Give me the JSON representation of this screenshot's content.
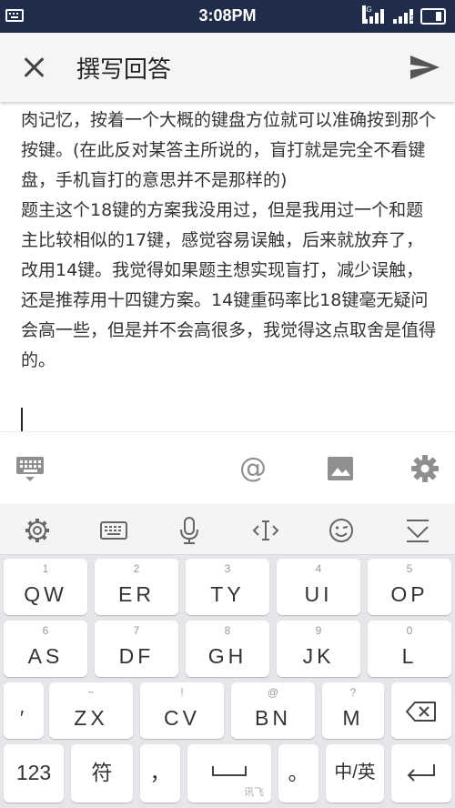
{
  "status_bar": {
    "time": "3:08PM",
    "signal1_tag": "4G",
    "signal2_tag": "2"
  },
  "app_bar": {
    "title": "撰写回答"
  },
  "editor": {
    "text": "肉记忆，按着一个大概的键盘方位就可以准确按到那个按键。(在此反对某答主所说的，盲打就是完全不看键盘，手机盲打的意思并不是那样的)\n题主这个18键的方案我没用过，但是我用过一个和题主比较相似的17键，感觉容易误触，后来就放弃了，改用14键。我觉得如果题主想实现盲打，减少误触，还是推荐用十四键方案。14键重码率比18键毫无疑问会高一些，但是并不会高很多，我觉得这点取舍是值得的。"
  },
  "toolbar": {
    "at_symbol": "@"
  },
  "keyboard": {
    "row1": [
      {
        "num": "1",
        "main": "QW"
      },
      {
        "num": "2",
        "main": "ER"
      },
      {
        "num": "3",
        "main": "TY"
      },
      {
        "num": "4",
        "main": "UI"
      },
      {
        "num": "5",
        "main": "OP"
      }
    ],
    "row2": [
      {
        "num": "6",
        "main": "AS"
      },
      {
        "num": "7",
        "main": "DF"
      },
      {
        "num": "8",
        "main": "GH"
      },
      {
        "num": "9",
        "main": "JK"
      },
      {
        "num": "0",
        "main": "L"
      }
    ],
    "row3": [
      {
        "num": "",
        "main": "′"
      },
      {
        "num": "~",
        "main": "ZX"
      },
      {
        "num": "!",
        "main": "CV"
      },
      {
        "num": "@",
        "main": "BN"
      },
      {
        "num": "?",
        "main": "M"
      }
    ],
    "row4": {
      "num": "123",
      "symbols": "符",
      "comma": "，",
      "brand": "讯飞",
      "period": "。",
      "lang": "中/英"
    }
  },
  "colors": {
    "status_bg": "#1f2d4a",
    "appbar_bg": "#f5f5f5",
    "keyboard_bg": "#e4e6ea",
    "key_bg": "#ffffff",
    "icon_gray": "#8f8f8f"
  }
}
